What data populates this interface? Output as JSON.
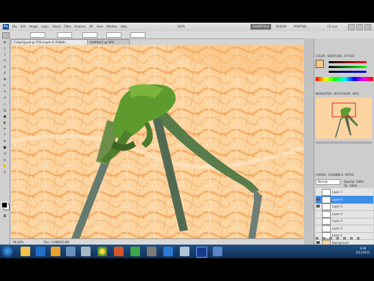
{
  "app": {
    "logo": "Ps",
    "menus": [
      "File",
      "Edit",
      "Image",
      "Layer",
      "Select",
      "Filter",
      "Analysis",
      "3D",
      "View",
      "Window",
      "Help"
    ],
    "zoom": "100%",
    "workspace_active": "ESSENTIALS",
    "workspace_others": [
      "DESIGN",
      "PAINTING"
    ],
    "cs_live": "CS Live"
  },
  "document": {
    "tab_title": "Craig-Fg.psd @ 75% (Layer 6, RGB/8)",
    "tab2_title": "Untitled-1 @ 50%",
    "zoom_status": "66.69%",
    "doc_status": "Doc: 3.00M/45.6M"
  },
  "panels": {
    "color_tabs": [
      "COLOR",
      "SWATCHES",
      "STYLES"
    ],
    "navigator_tabs": [
      "NAVIGATOR",
      "HISTOGRAM",
      "INFO"
    ],
    "layers_tabs": [
      "LAYERS",
      "CHANNELS",
      "PATHS"
    ],
    "blend_mode": "Normal",
    "opacity_label": "Opacity: 100%",
    "fill_label": "Fill: 100%",
    "fg_color": "#f8c884",
    "layers": [
      {
        "name": "Layer 7",
        "selected": false,
        "visible": false
      },
      {
        "name": "Layer 6",
        "selected": true,
        "visible": true
      },
      {
        "name": "Layer 5",
        "selected": false,
        "visible": true
      },
      {
        "name": "Layer 4",
        "selected": false,
        "visible": false
      },
      {
        "name": "Layer 3",
        "selected": false,
        "visible": false
      },
      {
        "name": "Layer 2",
        "selected": false,
        "visible": false
      },
      {
        "name": "Layer 1",
        "selected": false,
        "visible": false
      },
      {
        "name": "Background",
        "selected": false,
        "visible": true
      }
    ]
  },
  "taskbar": {
    "time": "9:38",
    "date": "2/11/2011"
  },
  "colors": {
    "canvas_bg": "#fcd4a0",
    "canvas_texture": "#f7ae62",
    "creature": "#5e9b2e",
    "selection": "#3d8ee8",
    "taskbar": "#1f4f84"
  }
}
